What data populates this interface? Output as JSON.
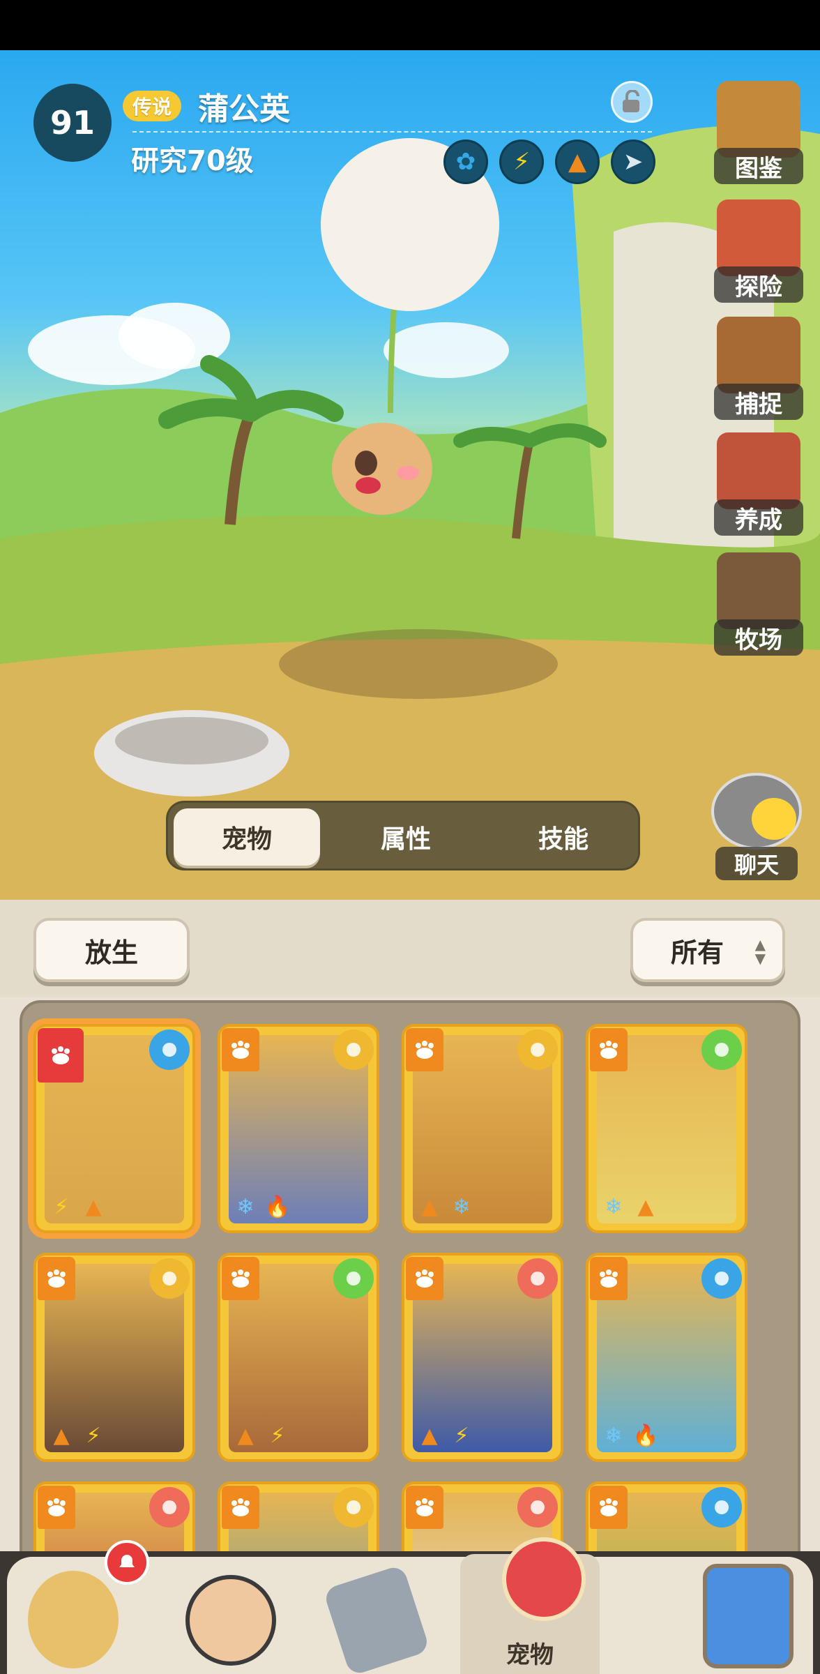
{
  "header": {
    "level": "91",
    "rarity": "传说",
    "pet_name": "蒲公英",
    "research": "研究70级"
  },
  "type_icons": [
    {
      "name": "grass-wind-icon",
      "color": "#35a8e8"
    },
    {
      "name": "lightning-icon",
      "color": "#ffd21e"
    },
    {
      "name": "earth-icon",
      "color": "#f08a1e"
    },
    {
      "name": "wing-icon",
      "color": "#dfe8ee"
    }
  ],
  "side_menu": [
    {
      "label": "图鉴",
      "icon": "book-icon"
    },
    {
      "label": "探险",
      "icon": "adventure-icon"
    },
    {
      "label": "捕捉",
      "icon": "cage-icon"
    },
    {
      "label": "养成",
      "icon": "training-icon"
    },
    {
      "label": "牧场",
      "icon": "ranch-icon"
    }
  ],
  "tabs": [
    {
      "label": "宠物",
      "active": true
    },
    {
      "label": "属性",
      "active": false
    },
    {
      "label": "技能",
      "active": false
    }
  ],
  "chat_label": "聊天",
  "panel": {
    "release_label": "放生",
    "filter_label": "所有"
  },
  "pets": [
    {
      "row": 0,
      "col": 0,
      "tag": "paw",
      "elem": "wind",
      "elem_color": "#3aa5e6",
      "bottom": [
        "⚡",
        "▲"
      ],
      "selected": true,
      "art": "#d9a64a"
    },
    {
      "row": 0,
      "col": 1,
      "tag": "hat",
      "elem": "metal",
      "elem_color": "#f0b730",
      "bottom": [
        "❄",
        "🔥"
      ],
      "selected": false,
      "art": "#6d7fb8"
    },
    {
      "row": 0,
      "col": 2,
      "tag": "hat",
      "elem": "metal",
      "elem_color": "#f0b730",
      "bottom": [
        "▲",
        "❄"
      ],
      "selected": false,
      "art": "#c9893a"
    },
    {
      "row": 0,
      "col": 3,
      "tag": "hat",
      "elem": "heal",
      "elem_color": "#6ccf4a",
      "bottom": [
        "❄",
        "▲"
      ],
      "selected": false,
      "art": "#e9d36a"
    },
    {
      "row": 1,
      "col": 0,
      "tag": "hat",
      "elem": "metal",
      "elem_color": "#f0b730",
      "bottom": [
        "▲",
        "⚡"
      ],
      "selected": false,
      "art": "#6a4a36"
    },
    {
      "row": 1,
      "col": 1,
      "tag": "hat",
      "elem": "heal",
      "elem_color": "#6ccf4a",
      "bottom": [
        "▲",
        "⚡"
      ],
      "selected": false,
      "art": "#a8693a"
    },
    {
      "row": 1,
      "col": 2,
      "tag": "hat",
      "elem": "beast",
      "elem_color": "#ef6b5a",
      "bottom": [
        "▲",
        "⚡"
      ],
      "selected": false,
      "art": "#3e5aa8"
    },
    {
      "row": 1,
      "col": 3,
      "tag": "hat",
      "elem": "wind",
      "elem_color": "#3aa5e6",
      "bottom": [
        "❄",
        "🔥"
      ],
      "selected": false,
      "art": "#5fb0d6"
    },
    {
      "row": 2,
      "col": 0,
      "tag": "hat",
      "elem": "beast",
      "elem_color": "#ef6b5a",
      "bottom": [],
      "selected": false,
      "art": "#b84a3a"
    },
    {
      "row": 2,
      "col": 1,
      "tag": "hat",
      "elem": "metal",
      "elem_color": "#f0b730",
      "bottom": [],
      "selected": false,
      "art": "#5a9aa8"
    },
    {
      "row": 2,
      "col": 2,
      "tag": "hat",
      "elem": "beast",
      "elem_color": "#ef6b5a",
      "bottom": [],
      "selected": false,
      "art": "#dcdcdc"
    },
    {
      "row": 2,
      "col": 3,
      "tag": "hat",
      "elem": "wind",
      "elem_color": "#3aa5e6",
      "bottom": [],
      "selected": false,
      "art": "#8ab05a"
    }
  ],
  "bottom_nav": [
    {
      "icon": "caveman-icon",
      "label": "",
      "active": false
    },
    {
      "icon": "hero-icon",
      "label": "",
      "active": false
    },
    {
      "icon": "weapon-icon",
      "label": "",
      "active": false
    },
    {
      "icon": "pet-icon",
      "label": "宠物",
      "active": true
    },
    {
      "icon": "portal-icon",
      "label": "",
      "active": false
    }
  ]
}
